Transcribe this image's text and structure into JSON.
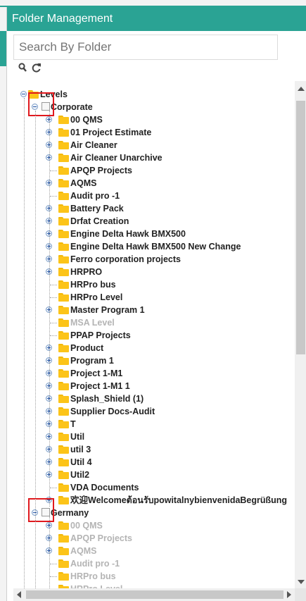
{
  "dialog": {
    "title": "Folder Management",
    "search_placeholder": "Search By Folder",
    "toolbar": {
      "search_icon": "search-icon",
      "refresh_icon": "refresh-icon"
    }
  },
  "colors": {
    "accent": "#2aa394",
    "folder": "#fcc419",
    "highlight": "#e0191e",
    "disabled_text": "#b4b4b4"
  },
  "tree": {
    "root": {
      "label": "Levels",
      "expanded": true
    },
    "groups": [
      {
        "label": "Corporate",
        "expanded": true,
        "children": [
          {
            "label": "00 QMS",
            "expandable": true,
            "disabled": false
          },
          {
            "label": "01 Project Estimate",
            "expandable": true,
            "disabled": false
          },
          {
            "label": "Air Cleaner",
            "expandable": true,
            "disabled": false
          },
          {
            "label": "Air Cleaner Unarchive",
            "expandable": true,
            "disabled": false
          },
          {
            "label": "APQP Projects",
            "expandable": false,
            "disabled": false
          },
          {
            "label": "AQMS",
            "expandable": true,
            "disabled": false
          },
          {
            "label": "Audit pro -1",
            "expandable": false,
            "disabled": false
          },
          {
            "label": "Battery Pack",
            "expandable": true,
            "disabled": false
          },
          {
            "label": "Drfat Creation",
            "expandable": true,
            "disabled": false
          },
          {
            "label": "Engine Delta Hawk BMX500",
            "expandable": true,
            "disabled": false
          },
          {
            "label": "Engine Delta Hawk BMX500 New Change",
            "expandable": true,
            "disabled": false
          },
          {
            "label": "Ferro corporation projects",
            "expandable": true,
            "disabled": false
          },
          {
            "label": "HRPRO",
            "expandable": true,
            "disabled": false
          },
          {
            "label": "HRPro bus",
            "expandable": false,
            "disabled": false
          },
          {
            "label": "HRPro Level",
            "expandable": false,
            "disabled": false
          },
          {
            "label": "Master Program 1",
            "expandable": true,
            "disabled": false
          },
          {
            "label": "MSA Level",
            "expandable": false,
            "disabled": true
          },
          {
            "label": "PPAP Projects",
            "expandable": false,
            "disabled": false
          },
          {
            "label": "Product",
            "expandable": true,
            "disabled": false
          },
          {
            "label": "Program 1",
            "expandable": true,
            "disabled": false
          },
          {
            "label": "Project 1-M1",
            "expandable": true,
            "disabled": false
          },
          {
            "label": "Project 1-M1 1",
            "expandable": true,
            "disabled": false
          },
          {
            "label": "Splash_Shield (1)",
            "expandable": true,
            "disabled": false
          },
          {
            "label": "Supplier Docs-Audit",
            "expandable": true,
            "disabled": false
          },
          {
            "label": "T",
            "expandable": true,
            "disabled": false
          },
          {
            "label": "Util",
            "expandable": true,
            "disabled": false
          },
          {
            "label": "util 3",
            "expandable": true,
            "disabled": false
          },
          {
            "label": "Util 4",
            "expandable": true,
            "disabled": false
          },
          {
            "label": "Util2",
            "expandable": true,
            "disabled": false
          },
          {
            "label": "VDA Documents",
            "expandable": false,
            "disabled": false
          },
          {
            "label": "欢迎Welcomeต้อนรับpowitalnybienvenidaBegrüßung",
            "expandable": true,
            "disabled": false
          }
        ]
      },
      {
        "label": "Germany",
        "expanded": true,
        "children": [
          {
            "label": "00 QMS",
            "expandable": true,
            "disabled": true
          },
          {
            "label": "APQP Projects",
            "expandable": true,
            "disabled": true
          },
          {
            "label": "AQMS",
            "expandable": true,
            "disabled": true
          },
          {
            "label": "Audit pro -1",
            "expandable": false,
            "disabled": true
          },
          {
            "label": "HRPro bus",
            "expandable": false,
            "disabled": true
          },
          {
            "label": "HRPro Level",
            "expandable": false,
            "disabled": true
          }
        ]
      }
    ]
  }
}
